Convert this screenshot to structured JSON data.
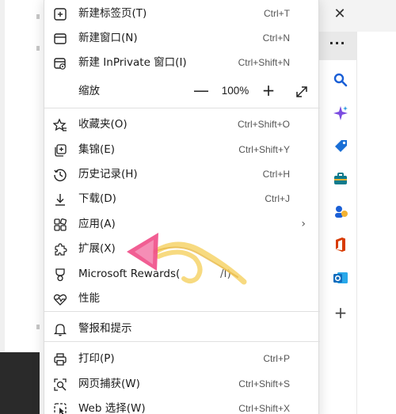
{
  "menu": {
    "items": [
      {
        "label": "新建标签页(T)",
        "shortcut": "Ctrl+T",
        "icon": "new-tab-icon"
      },
      {
        "label": "新建窗口(N)",
        "shortcut": "Ctrl+N",
        "icon": "new-window-icon"
      },
      {
        "label": "新建 InPrivate 窗口(I)",
        "shortcut": "Ctrl+Shift+N",
        "icon": "inprivate-window-icon"
      },
      {
        "label": "收藏夹(O)",
        "shortcut": "Ctrl+Shift+O",
        "icon": "favorites-icon"
      },
      {
        "label": "集锦(E)",
        "shortcut": "Ctrl+Shift+Y",
        "icon": "collections-icon"
      },
      {
        "label": "历史记录(H)",
        "shortcut": "Ctrl+H",
        "icon": "history-icon"
      },
      {
        "label": "下载(D)",
        "shortcut": "Ctrl+J",
        "icon": "download-icon"
      },
      {
        "label": "应用(A)",
        "shortcut": "",
        "icon": "apps-icon"
      },
      {
        "label": "扩展(X)",
        "shortcut": "",
        "icon": "extensions-icon"
      },
      {
        "label": "Microsoft Rewards(",
        "shortcut": "",
        "icon": "rewards-icon"
      },
      {
        "label": "性能",
        "shortcut": "",
        "icon": "performance-icon"
      },
      {
        "label": "警报和提示",
        "shortcut": "",
        "icon": "alerts-icon"
      },
      {
        "label": "打印(P)",
        "shortcut": "Ctrl+P",
        "icon": "print-icon"
      },
      {
        "label": "网页捕获(W)",
        "shortcut": "Ctrl+Shift+S",
        "icon": "web-capture-icon"
      },
      {
        "label": "Web 选择(W)",
        "shortcut": "Ctrl+Shift+X",
        "icon": "web-select-icon"
      }
    ],
    "zoom": {
      "label": "缩放",
      "minus": "—",
      "value": "100%",
      "plus": "+"
    },
    "rewards_suffix": "/I)",
    "apps_chevron": "›"
  },
  "chrome": {
    "close": "✕",
    "more": "···",
    "side_add": "+"
  },
  "colors": {
    "accent_blue": "#1a5fd6",
    "copilot_purple": "#7b4ce0",
    "office_red": "#d83b01",
    "outlook_blue": "#0f6cbd",
    "tools_teal": "#0f7b8c",
    "doodle_pink": "#f0508a",
    "doodle_yellow": "#f6d46a"
  }
}
